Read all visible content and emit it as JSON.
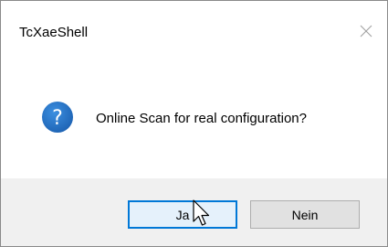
{
  "window": {
    "title": "TcXaeShell",
    "close_icon": "close-icon"
  },
  "message": {
    "icon": "question-icon",
    "icon_color": "#1e6dc0",
    "text": "Online Scan for real configuration?"
  },
  "buttons": {
    "yes_label": "Ja",
    "no_label": "Nein",
    "default": "yes",
    "focus_color": "#0078d7"
  },
  "cursor": {
    "icon": "mouse-pointer-icon",
    "over": "yes"
  }
}
